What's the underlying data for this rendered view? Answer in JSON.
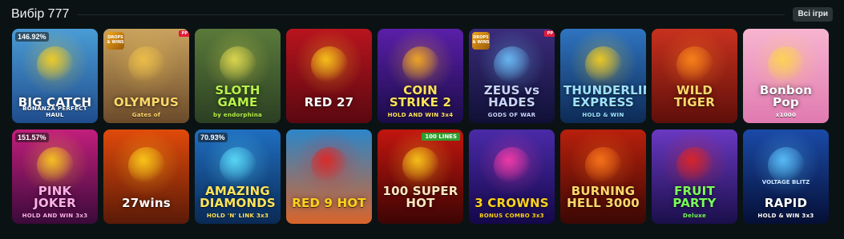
{
  "header": {
    "title": "Вибір 777",
    "all_label": "Всі ігри"
  },
  "games": [
    {
      "name": "BIG CATCH",
      "sub": "BONANZA PERFECT HAUL",
      "rtp": "146.92%",
      "bg": [
        "#4a9cd6",
        "#1f4c8c"
      ],
      "text": "#ffffff",
      "accent": "#ffd21a"
    },
    {
      "name": "OLYMPUS",
      "sub": "Gates of",
      "drops": "DROPS & WINS",
      "ribbon": "PP",
      "bg": [
        "#c9a25e",
        "#6a4a2a"
      ],
      "text": "#ffd86a",
      "accent": "#f1c24a"
    },
    {
      "name": "SLOTH GAME",
      "sub": "by endorphina",
      "bg": [
        "#5a7a3a",
        "#2b3f22"
      ],
      "text": "#b9f24a",
      "accent": "#e8e050"
    },
    {
      "name": "RED 27",
      "sub": "",
      "bg": [
        "#b8141e",
        "#5a0810"
      ],
      "text": "#ffffff",
      "accent": "#ffd11a"
    },
    {
      "name": "COIN STRIKE 2",
      "sub": "HOLD AND WIN 3x4",
      "bg": [
        "#5a1fa8",
        "#1a0c48"
      ],
      "text": "#ffe35a",
      "accent": "#ffb31a"
    },
    {
      "name": "ZEUS vs HADES",
      "sub": "GODS OF WAR",
      "drops": "DROPS & WINS",
      "ribbon": "PP",
      "bg": [
        "#3b2b7a",
        "#0f1036"
      ],
      "text": "#c9d5ff",
      "accent": "#6ec6ff"
    },
    {
      "name": "THUNDERLINE EXPRESS",
      "sub": "HOLD & WIN",
      "bg": [
        "#2f74c0",
        "#0d2a55"
      ],
      "text": "#9fe3ff",
      "accent": "#ffd21a"
    },
    {
      "name": "WILD TIGER",
      "sub": "",
      "bg": [
        "#c8311e",
        "#5e0f0a"
      ],
      "text": "#ffd86a",
      "accent": "#ff8a1a"
    },
    {
      "name": "Bonbon Pop",
      "sub": "x1000",
      "bg": [
        "#f7b4d0",
        "#e07ab0"
      ],
      "text": "#ffffff",
      "accent": "#ffd64a"
    },
    {
      "name": "PINK JOKER",
      "sub": "HOLD AND WIN 3x3",
      "rtp": "151.57%",
      "bg": [
        "#c21e7c",
        "#3a0a3a"
      ],
      "text": "#ffb0e8",
      "accent": "#ffd21a"
    },
    {
      "name": "27wins",
      "sub": "",
      "bg": [
        "#e04a0a",
        "#5a1a08"
      ],
      "text": "#ffffff",
      "accent": "#ffd21a"
    },
    {
      "name": "AMAZING DIAMONDS",
      "sub": "HOLD 'N' LINK 3x3",
      "rtp": "70.93%",
      "bg": [
        "#1f6ec0",
        "#0a2a55"
      ],
      "text": "#ffe35a",
      "accent": "#5ee2ff"
    },
    {
      "name": "RED 9 HOT",
      "sub": "",
      "bg": [
        "#2c86c9",
        "#d9642a"
      ],
      "text": "#ffd21a",
      "accent": "#e5231e"
    },
    {
      "name": "100 SUPER HOT",
      "sub": "",
      "lines": "100 LINES",
      "bg": [
        "#c2150f",
        "#3c0504"
      ],
      "text": "#ffe8c0",
      "accent": "#ffd21a"
    },
    {
      "name": "3 CROWNS",
      "sub": "BONUS COMBO 3x3",
      "bg": [
        "#4a2aa8",
        "#14084a"
      ],
      "text": "#ffd21a",
      "accent": "#ff3ca8"
    },
    {
      "name": "BURNING HELL 3000",
      "sub": "",
      "bg": [
        "#b8200c",
        "#3a0804"
      ],
      "text": "#ffd86a",
      "accent": "#ff7a1a"
    },
    {
      "name": "FRUIT PARTY",
      "sub": "Deluxe",
      "bg": [
        "#6a38c2",
        "#1a0f4a"
      ],
      "text": "#7aff5a",
      "accent": "#e5231e"
    },
    {
      "name": "RAPID",
      "sub": "HOLD & WIN 3x3",
      "brand": "VOLTAGE BLITZ",
      "bg": [
        "#1a4aa8",
        "#050f35"
      ],
      "text": "#ffffff",
      "accent": "#5ec8ff"
    }
  ]
}
